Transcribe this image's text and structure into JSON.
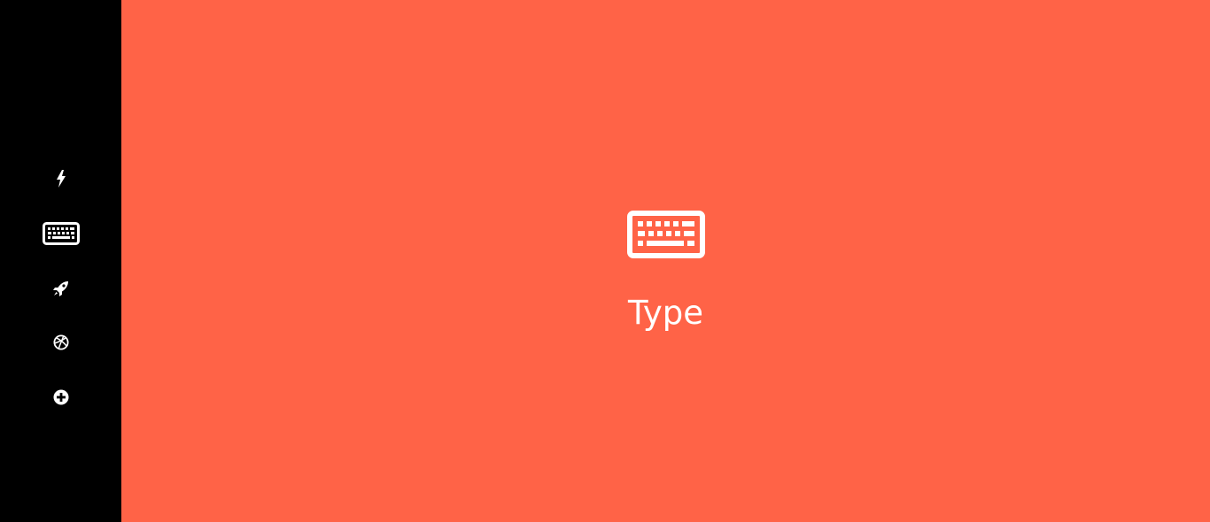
{
  "sidebar": {
    "items": [
      {
        "icon": "bolt-icon"
      },
      {
        "icon": "keyboard-icon"
      },
      {
        "icon": "rocket-icon"
      },
      {
        "icon": "dribbble-icon"
      },
      {
        "icon": "plus-circle-icon"
      }
    ]
  },
  "main": {
    "icon": "keyboard-icon",
    "title": "Type"
  },
  "colors": {
    "sidebar_bg": "#000000",
    "main_bg": "#ff6347",
    "foreground": "#ffffff"
  }
}
